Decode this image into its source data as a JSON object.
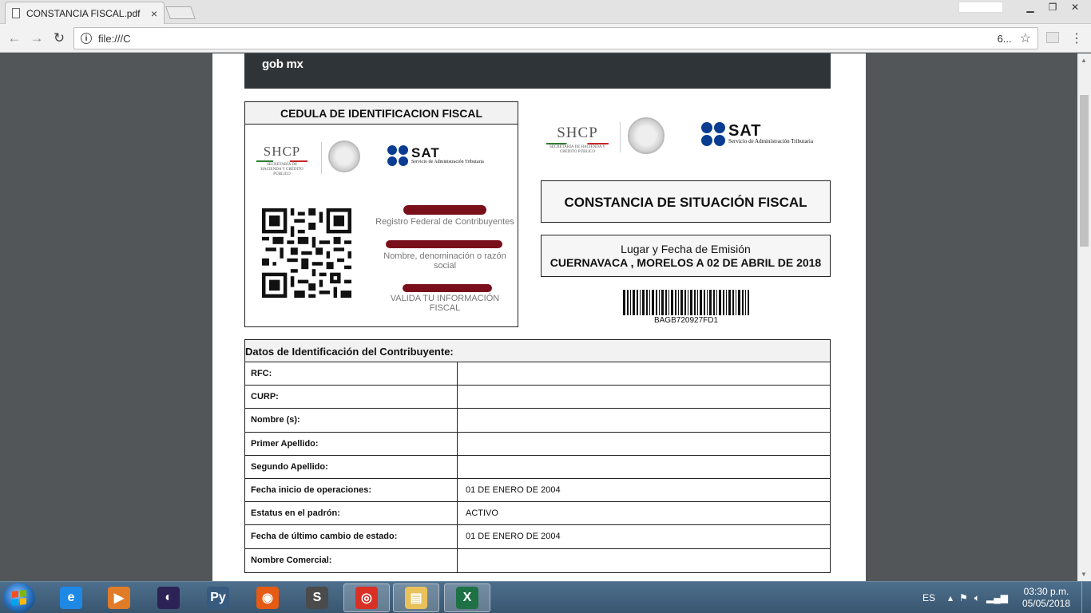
{
  "browser": {
    "tab_title": "CONSTANCIA FISCAL.pdf",
    "tab_close": "×",
    "url": "file:///C",
    "url_suffix": "6...",
    "star": "☆",
    "menu": "⋮",
    "back": "←",
    "forward": "→",
    "reload": "↻",
    "info": "i",
    "minimize": "▁",
    "restore": "❐",
    "close": "✕"
  },
  "document": {
    "banner_text": "gob mx",
    "cedula": {
      "title": "CEDULA DE IDENTIFICACION FISCAL",
      "rfc_label": "Registro Federal de Contribuyentes",
      "name_label": "Nombre, denominación o razón social",
      "valida_label": "VALIDA TU INFORMACIÓN FISCAL"
    },
    "logos": {
      "shcp": "SHCP",
      "shcp_sub": "SECRETARÍA DE HACIENDA Y CRÉDITO PÚBLICO",
      "sat": "SAT",
      "sat_sub": "Servicio de Administración Tributaria"
    },
    "constancia_title": "CONSTANCIA DE SITUACIÓN FISCAL",
    "lugar_label": "Lugar y Fecha de Emisión",
    "lugar_value": "CUERNAVACA , MORELOS A 02 DE ABRIL DE 2018",
    "barcode_text": "BAGB720927FD1",
    "datos": {
      "title": "Datos de Identificación del Contribuyente:",
      "rows": [
        {
          "label": "RFC:",
          "value": ""
        },
        {
          "label": "CURP:",
          "value": ""
        },
        {
          "label": "Nombre (s):",
          "value": ""
        },
        {
          "label": "Primer Apellido:",
          "value": ""
        },
        {
          "label": "Segundo Apellido:",
          "value": ""
        },
        {
          "label": "Fecha inicio de operaciones:",
          "value": " 01 DE ENERO DE 2004"
        },
        {
          "label": "Estatus en el padrón:",
          "value": "ACTIVO"
        },
        {
          "label": "Fecha de último cambio de estado:",
          "value": " 01 DE ENERO DE 2004"
        },
        {
          "label": "Nombre Comercial:",
          "value": ""
        }
      ]
    }
  },
  "taskbar": {
    "lang": "ES",
    "time": "03:30 p.m.",
    "date": "05/05/2018",
    "apps": [
      {
        "name": "internet-explorer",
        "glyph": "e",
        "color": "#1e88e5"
      },
      {
        "name": "media-player",
        "glyph": "▶",
        "color": "#e07b28"
      },
      {
        "name": "eclipse",
        "glyph": "◐",
        "color": "#2c2255"
      },
      {
        "name": "python-idle",
        "glyph": "Py",
        "color": "#375a7f"
      },
      {
        "name": "firefox",
        "glyph": "◉",
        "color": "#e55b13"
      },
      {
        "name": "sublime-text",
        "glyph": "S",
        "color": "#4b4b4b"
      },
      {
        "name": "chrome",
        "glyph": "◎",
        "color": "#d93025"
      },
      {
        "name": "file-explorer",
        "glyph": "▤",
        "color": "#e8c15a"
      },
      {
        "name": "excel",
        "glyph": "X",
        "color": "#1e7145"
      }
    ]
  }
}
